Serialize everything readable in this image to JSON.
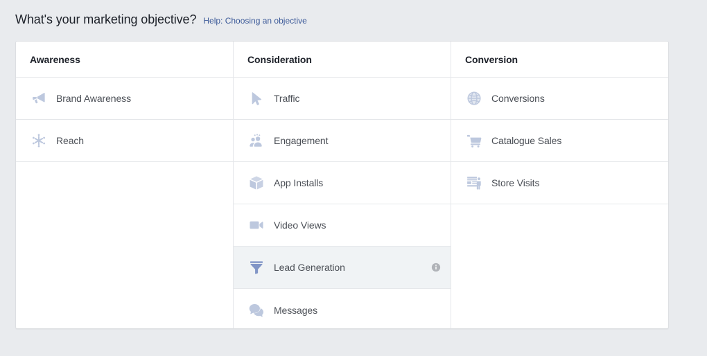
{
  "header": {
    "title": "What's your marketing objective?",
    "help_link": "Help: Choosing an objective"
  },
  "colors": {
    "page_background": "#e9ebee",
    "card_background": "#ffffff",
    "border": "#dddfe2",
    "row_divider": "#e5e7ea",
    "link": "#3b5998",
    "title_text": "#1d2129",
    "label_text": "#4b4f56",
    "icon_default": "#bdc8de",
    "icon_selected": "#8195c6",
    "row_selected_background": "#f0f3f5",
    "info_icon": "#b0b3b8"
  },
  "columns": [
    {
      "header": "Awareness",
      "items": [
        {
          "label": "Brand Awareness",
          "icon": "megaphone-icon",
          "selected": false,
          "has_info": false
        },
        {
          "label": "Reach",
          "icon": "reach-burst-icon",
          "selected": false,
          "has_info": false
        }
      ]
    },
    {
      "header": "Consideration",
      "items": [
        {
          "label": "Traffic",
          "icon": "cursor-arrow-icon",
          "selected": false,
          "has_info": false
        },
        {
          "label": "Engagement",
          "icon": "people-icon",
          "selected": false,
          "has_info": false
        },
        {
          "label": "App Installs",
          "icon": "box-icon",
          "selected": false,
          "has_info": false
        },
        {
          "label": "Video Views",
          "icon": "video-camera-icon",
          "selected": false,
          "has_info": false
        },
        {
          "label": "Lead Generation",
          "icon": "funnel-icon",
          "selected": true,
          "has_info": true
        },
        {
          "label": "Messages",
          "icon": "chat-bubbles-icon",
          "selected": false,
          "has_info": false
        }
      ]
    },
    {
      "header": "Conversion",
      "items": [
        {
          "label": "Conversions",
          "icon": "globe-icon",
          "selected": false,
          "has_info": false
        },
        {
          "label": "Catalogue Sales",
          "icon": "shopping-cart-icon",
          "selected": false,
          "has_info": false
        },
        {
          "label": "Store Visits",
          "icon": "storefront-icon",
          "selected": false,
          "has_info": false
        }
      ]
    }
  ]
}
